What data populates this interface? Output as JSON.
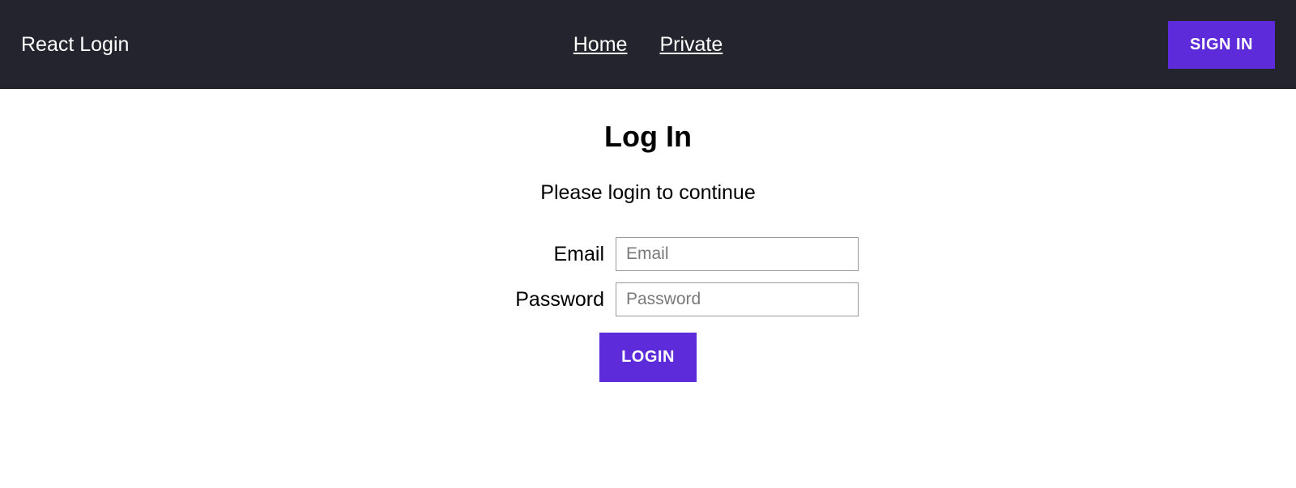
{
  "nav": {
    "brand": "React Login",
    "links": {
      "home": "Home",
      "private": "Private"
    },
    "signin_label": "SIGN IN"
  },
  "login": {
    "title": "Log In",
    "subtitle": "Please login to continue",
    "email_label": "Email",
    "email_placeholder": "Email",
    "password_label": "Password",
    "password_placeholder": "Password",
    "submit_label": "LOGIN"
  }
}
